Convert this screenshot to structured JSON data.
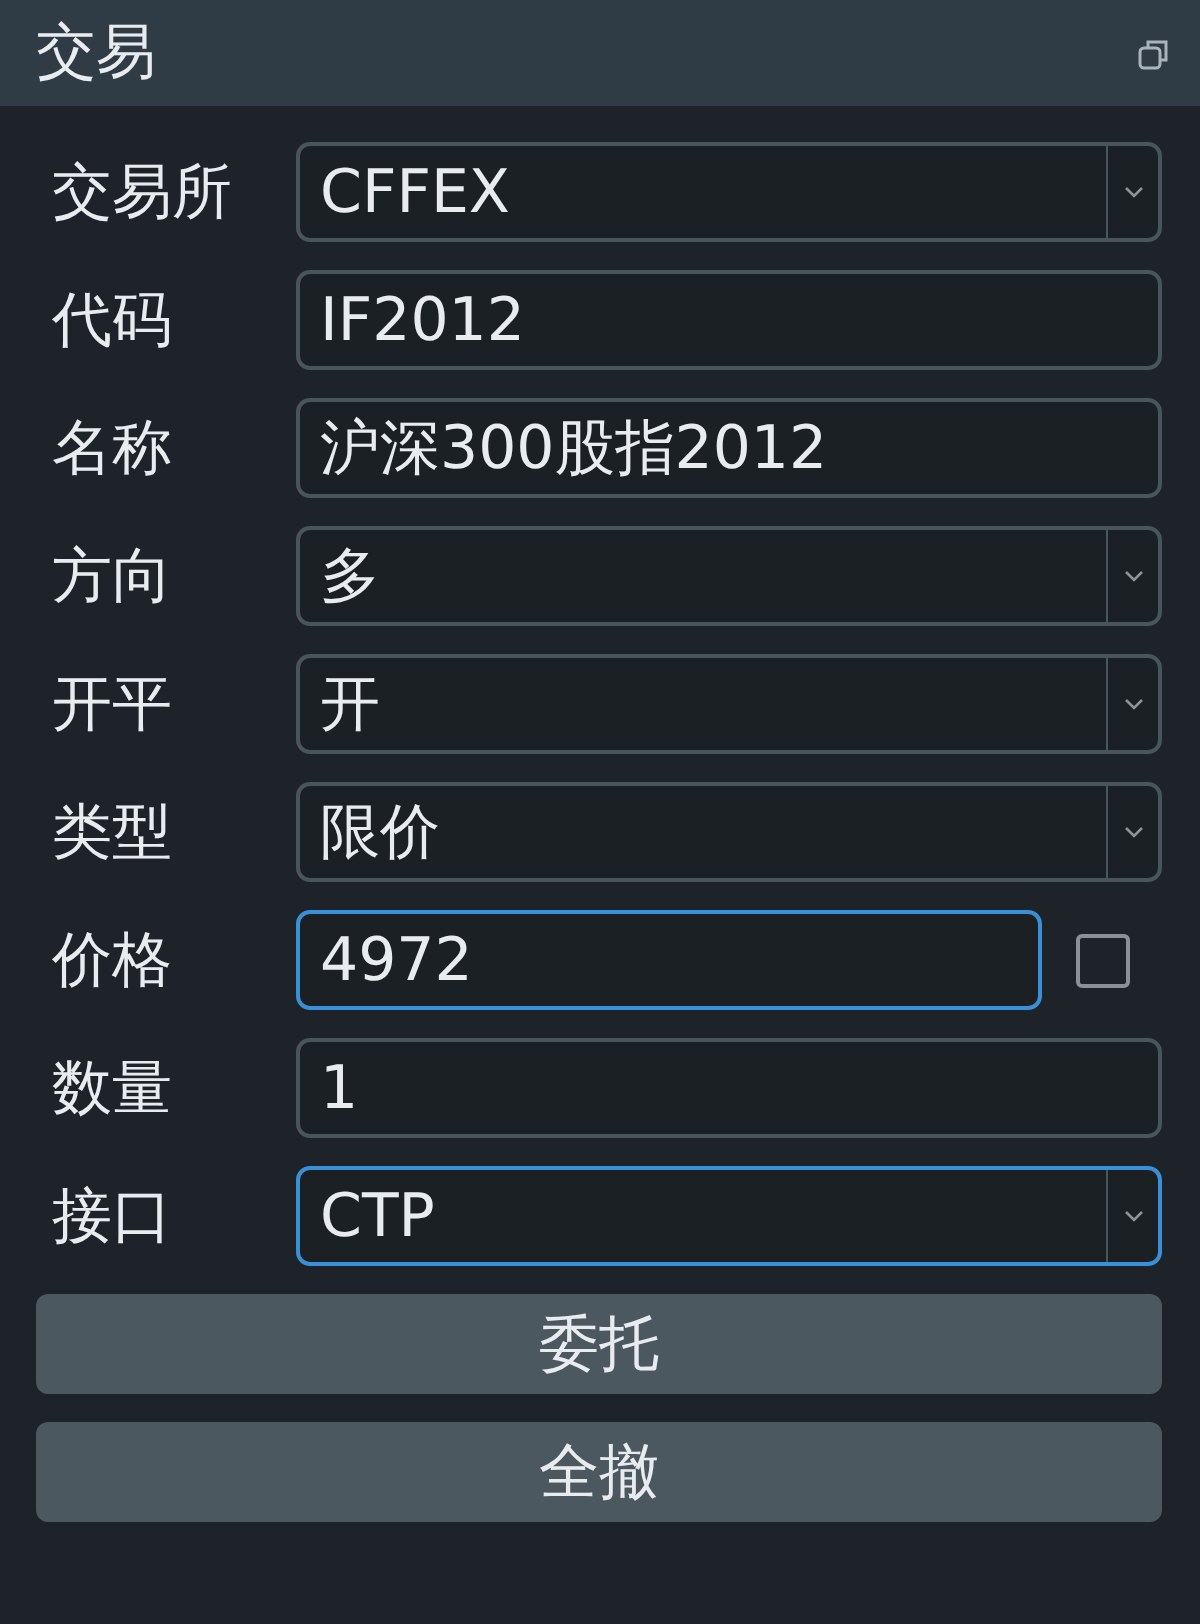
{
  "window": {
    "title": "交易"
  },
  "fields": [
    {
      "label": "交易所",
      "kind": "select",
      "value": "CFFEX",
      "focused": false
    },
    {
      "label": "代码",
      "kind": "text",
      "value": "IF2012",
      "focused": false
    },
    {
      "label": "名称",
      "kind": "text",
      "value": "沪深300股指2012",
      "focused": false
    },
    {
      "label": "方向",
      "kind": "select",
      "value": "多",
      "focused": false
    },
    {
      "label": "开平",
      "kind": "select",
      "value": "开",
      "focused": false
    },
    {
      "label": "类型",
      "kind": "select",
      "value": "限价",
      "focused": false
    },
    {
      "label": "价格",
      "kind": "text",
      "value": "4972",
      "focused": true,
      "checkbox": {
        "checked": false
      }
    },
    {
      "label": "数量",
      "kind": "text",
      "value": "1",
      "focused": false
    },
    {
      "label": "接口",
      "kind": "select",
      "value": "CTP",
      "focused": true
    }
  ],
  "buttons": [
    "委托",
    "全撤"
  ]
}
